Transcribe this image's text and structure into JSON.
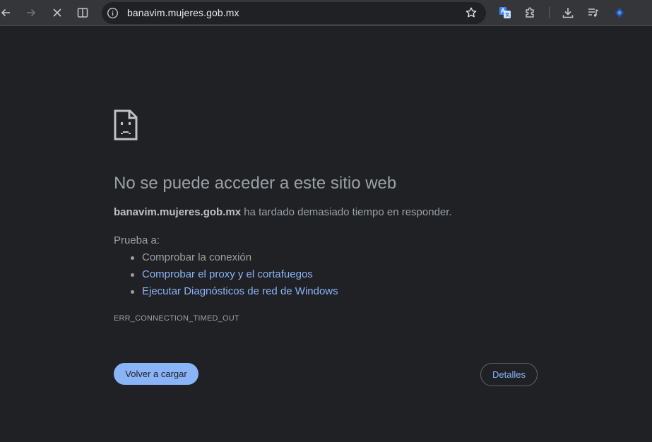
{
  "toolbar": {
    "url": "banavim.mujeres.gob.mx",
    "icons": [
      "back-icon",
      "forward-icon",
      "stop-icon",
      "split-view-icon",
      "site-info-icon",
      "bookmark-star-icon",
      "translate-icon",
      "extensions-icon",
      "download-icon",
      "media-queue-icon",
      "extension-icon"
    ]
  },
  "error": {
    "title": "No se puede acceder a este sitio web",
    "host": "banavim.mujeres.gob.mx",
    "message": " ha tardado demasiado tiempo en responder.",
    "try_label": "Prueba a:",
    "suggestions": [
      {
        "text": "Comprobar la conexión"
      },
      {
        "text": "Comprobar el proxy y el cortafuegos"
      },
      {
        "text": "Ejecutar Diagnósticos de red de Windows"
      }
    ],
    "code": "ERR_CONNECTION_TIMED_OUT",
    "reload_label": "Volver a cargar",
    "details_label": "Detalles"
  },
  "colors": {
    "background": "#202124",
    "toolbar": "#35363a",
    "link": "#8ab4f8",
    "text": "#9aa0a6"
  }
}
